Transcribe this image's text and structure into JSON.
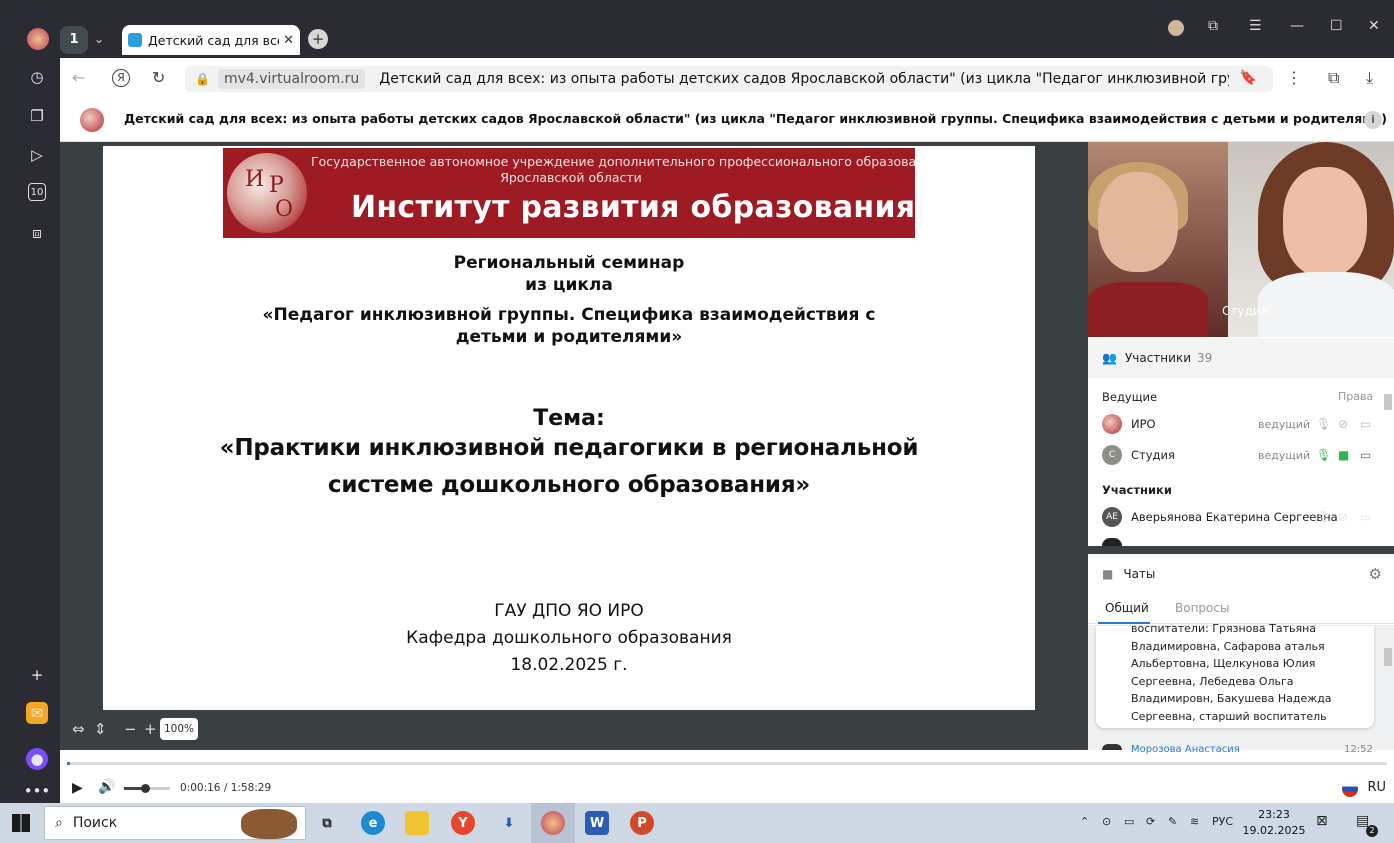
{
  "browser": {
    "tab_count": "1",
    "tab_title": "Детский сад для всех: ",
    "host": "mv4.virtualroom.ru",
    "page_title": "Детский сад для всех: из опыта работы детских садов Ярославской области\" (из цикла \"Педагог инклюзивной группы. Сп..."
  },
  "site": {
    "heading": "Детский сад для всех: из опыта работы детских садов Ярославской области\" (из цикла \"Педагог инклюзивной группы. Специфика взаимодействия с детьми и родителями)"
  },
  "slide": {
    "banner_line1": "Государственное автономное учреждение дополнительного профессионального образования",
    "banner_line2": "Ярославской области",
    "banner_title": "Институт развития образования",
    "logo_letters": [
      "И",
      "Р",
      "О"
    ],
    "seminar_line1": "Региональный семинар",
    "seminar_line2": "из цикла",
    "cycle_line1": "«Педагог инклюзивной группы. Специфика взаимодействия с",
    "cycle_line2": "детьми и родителями»",
    "theme_label": "Тема:",
    "theme_line1": "«Практики инклюзивной педагогики в региональной",
    "theme_line2": "системе дошкольного образования»",
    "org": "ГАУ ДПО ЯО ИРО",
    "dept": "Кафедра дошкольного образования",
    "date": "18.02.2025  г."
  },
  "zoom": {
    "value": "100%"
  },
  "player": {
    "time": "0:00:16 / 1:58:29",
    "lang": "RU",
    "progress": 0.002,
    "volume": 0.45
  },
  "video": {
    "label": "Студия"
  },
  "participants": {
    "title": "Участники",
    "count": "39",
    "hosts_label": "Ведущие",
    "rights_label": "Права",
    "hosts": [
      {
        "name": "ИРО",
        "role": "ведущий"
      },
      {
        "name": "Студия",
        "initial": "С",
        "role": "ведущий"
      }
    ],
    "members_label": "Участники",
    "members": [
      {
        "name": "Аверьянова Екатерина Сергеевна",
        "initials": "АЕ"
      }
    ]
  },
  "chat": {
    "title": "Чаты",
    "tab_all": "Общий",
    "tab_questions": "Вопросы",
    "message": "воспитатели: Грязнова Татьяна Владимировна, Сафарова аталья Альбертовна, Щелкунова Юлия Сергеевна, Лебедева Ольга Владимировн, Бакушева Надежда Сергеевна, старший воспитатель Аверьянова Наталья Борисовна",
    "next_name": "Морозова Анастасия",
    "next_time": "12:52"
  },
  "taskbar": {
    "search_label": "Поиск",
    "lang": "РУС",
    "time": "23:23",
    "date": "19.02.2025",
    "notif": "2"
  },
  "colors": {
    "brand": "#9e1b24",
    "accent": "#2a7ad2",
    "green": "#2db84d"
  }
}
